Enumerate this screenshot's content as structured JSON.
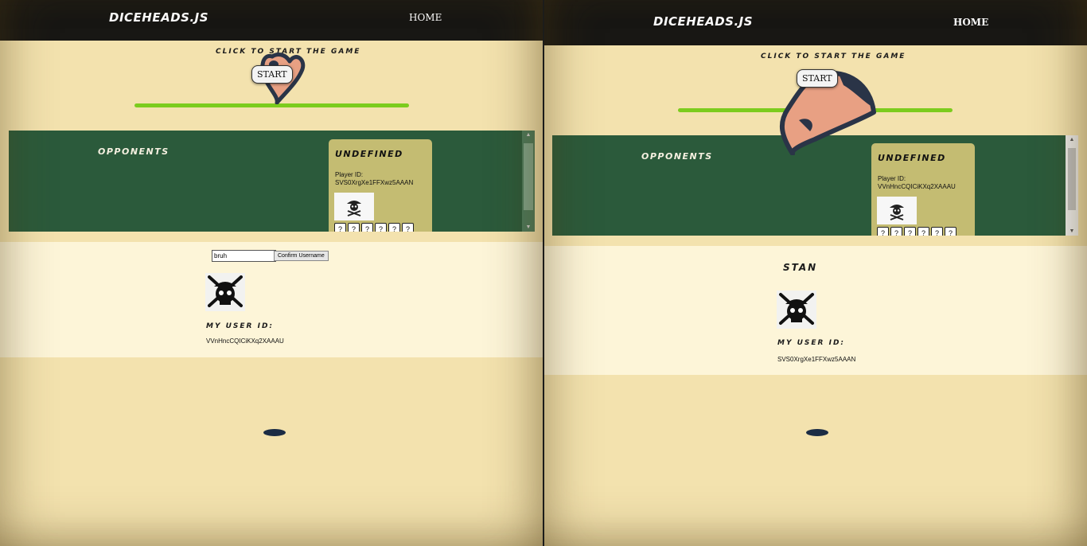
{
  "left_window": {
    "brand": "DICEHEADS.JS",
    "nav_home": "HOME",
    "start_prompt": "CLICK TO START THE GAME",
    "start_button": "START",
    "opponents_title": "OPPONENTS",
    "opponent_card": {
      "name": "UNDEFINED",
      "id_label": "Player ID:",
      "id_value": "SVS0XrgXe1FFXwz5AAAN",
      "avatar_icon": "pirate-skull-icon",
      "dice": [
        "?",
        "?",
        "?",
        "?",
        "?",
        "?"
      ]
    },
    "username_input_value": "bruh",
    "confirm_button": "Confirm Username",
    "avatar_icon": "pirate-skull-icon",
    "my_user_id_label": "MY USER ID:",
    "my_user_id_value": "VVnHncCQICiKXq2XAAAU"
  },
  "right_window": {
    "brand": "DICEHEADS.JS",
    "nav_home": "HOME",
    "start_prompt": "CLICK TO START THE GAME",
    "start_button": "START",
    "opponents_title": "OPPONENTS",
    "opponent_card": {
      "name": "UNDEFINED",
      "id_label": "Player ID:",
      "id_value": "VVnHncCQICiKXq2XAAAU",
      "avatar_icon": "pirate-skull-icon",
      "dice": [
        "?",
        "?",
        "?",
        "?",
        "?",
        "?"
      ]
    },
    "username_display": "STAN",
    "avatar_icon": "pirate-skull-icon",
    "my_user_id_label": "MY USER ID:",
    "my_user_id_value": "SVS0XrgXe1FFXwz5AAAN"
  },
  "colors": {
    "navbar": "#181714",
    "page_background": "#f3e2ae",
    "opponents_panel": "#2b5a3b",
    "opponent_card": "#c4bc72",
    "progress_bar": "#7ccc1e",
    "user_area": "#fdf5d8"
  }
}
